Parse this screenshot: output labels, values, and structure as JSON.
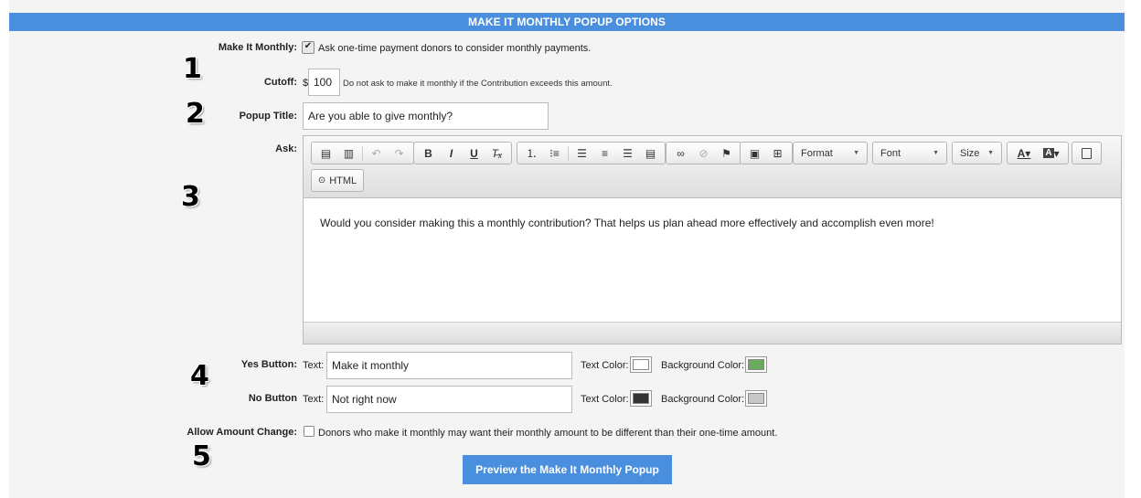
{
  "header": {
    "title": "MAKE IT MONTHLY POPUP OPTIONS"
  },
  "make_it_monthly": {
    "label": "Make It Monthly:",
    "checked": true,
    "description": "Ask one-time payment donors to consider monthly payments."
  },
  "cutoff": {
    "label": "Cutoff:",
    "currency": "$",
    "value": "100",
    "help": "Do not ask to make it monthly if the Contribution exceeds this amount."
  },
  "popup_title": {
    "label": "Popup Title:",
    "value": "Are you able to give monthly?"
  },
  "ask": {
    "label": "Ask:",
    "toolbar": {
      "format_label": "Format",
      "font_label": "Font",
      "size_label": "Size",
      "html_label": "HTML"
    },
    "body_text": "Would you consider making this a monthly contribution? That helps us plan ahead more effectively and accomplish even more!"
  },
  "yes_button": {
    "label": "Yes Button:",
    "text_label": "Text:",
    "text_value": "Make it monthly",
    "text_color_label": "Text Color:",
    "text_color": "#ffffff",
    "bg_color_label": "Background Color:",
    "bg_color": "#6aaa5c"
  },
  "no_button": {
    "label": "No Button",
    "text_label": "Text:",
    "text_value": "Not right now",
    "text_color_label": "Text Color:",
    "text_color": "#333333",
    "bg_color_label": "Background Color:",
    "bg_color": "#c8c8c8"
  },
  "allow_amount_change": {
    "label": "Allow Amount Change:",
    "checked": false,
    "description": "Donors who make it monthly may want their monthly amount to be different than their one-time amount."
  },
  "annotations": [
    "1",
    "2",
    "3",
    "4",
    "5"
  ],
  "preview_button": {
    "label": "Preview the Make It Monthly Popup"
  },
  "colors": {
    "accent": "#4a8fdd"
  }
}
